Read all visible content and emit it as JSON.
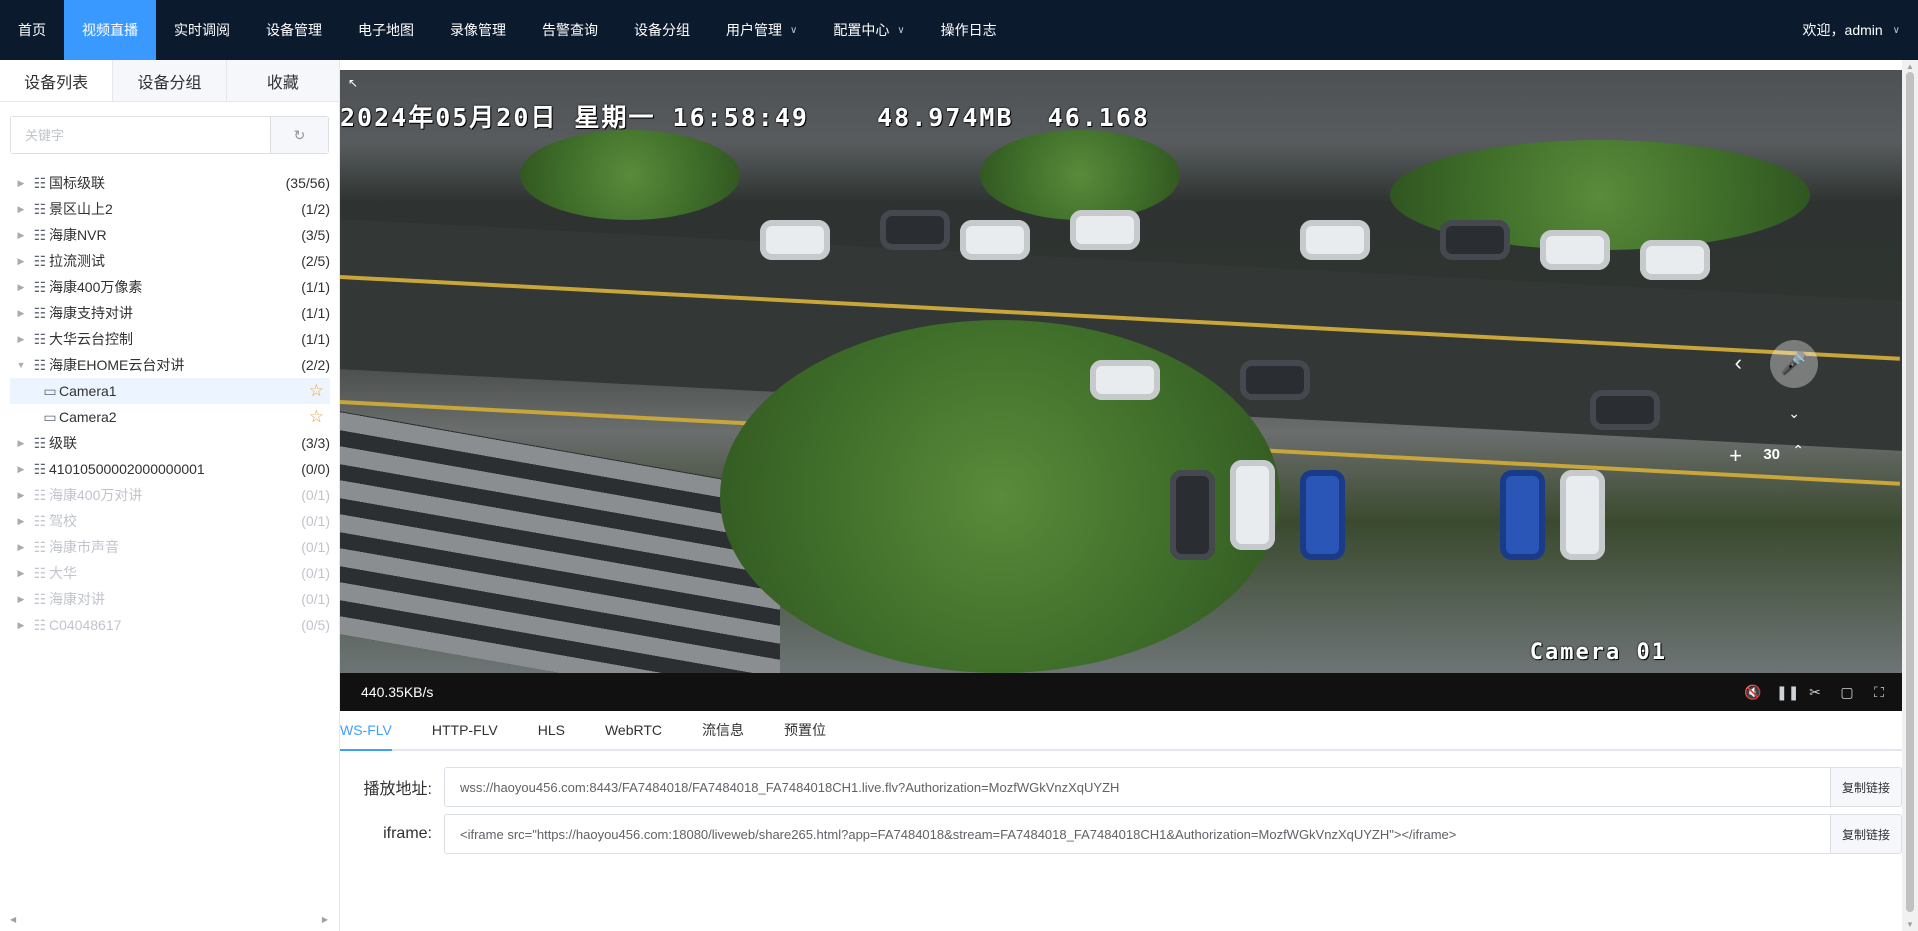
{
  "nav": {
    "items": [
      {
        "label": "首页",
        "active": false,
        "dropdown": false
      },
      {
        "label": "视频直播",
        "active": true,
        "dropdown": false
      },
      {
        "label": "实时调阅",
        "active": false,
        "dropdown": false
      },
      {
        "label": "设备管理",
        "active": false,
        "dropdown": false
      },
      {
        "label": "电子地图",
        "active": false,
        "dropdown": false
      },
      {
        "label": "录像管理",
        "active": false,
        "dropdown": false
      },
      {
        "label": "告警查询",
        "active": false,
        "dropdown": false
      },
      {
        "label": "设备分组",
        "active": false,
        "dropdown": false
      },
      {
        "label": "用户管理",
        "active": false,
        "dropdown": true
      },
      {
        "label": "配置中心",
        "active": false,
        "dropdown": true
      },
      {
        "label": "操作日志",
        "active": false,
        "dropdown": false
      }
    ],
    "user": "欢迎，admin"
  },
  "sidebar": {
    "tabs": [
      "设备列表",
      "设备分组",
      "收藏"
    ],
    "active_tab": 0,
    "search_placeholder": "关键字",
    "tree": [
      {
        "label": "国标级联",
        "count": "(35/56)",
        "type": "group",
        "expanded": false,
        "disabled": false
      },
      {
        "label": "景区山上2",
        "count": "(1/2)",
        "type": "group",
        "expanded": false,
        "disabled": false
      },
      {
        "label": "海康NVR",
        "count": "(3/5)",
        "type": "group",
        "expanded": false,
        "disabled": false
      },
      {
        "label": "拉流测试",
        "count": "(2/5)",
        "type": "group",
        "expanded": false,
        "disabled": false
      },
      {
        "label": "海康400万像素",
        "count": "(1/1)",
        "type": "group",
        "expanded": false,
        "disabled": false
      },
      {
        "label": "海康支持对讲",
        "count": "(1/1)",
        "type": "group",
        "expanded": false,
        "disabled": false
      },
      {
        "label": "大华云台控制",
        "count": "(1/1)",
        "type": "group",
        "expanded": false,
        "disabled": false
      },
      {
        "label": "海康EHOME云台对讲",
        "count": "(2/2)",
        "type": "group",
        "expanded": true,
        "disabled": false
      },
      {
        "label": "Camera1",
        "count": "",
        "type": "camera",
        "selected": true,
        "disabled": false
      },
      {
        "label": "Camera2",
        "count": "",
        "type": "camera",
        "selected": false,
        "disabled": false
      },
      {
        "label": "级联",
        "count": "(3/3)",
        "type": "group",
        "expanded": false,
        "disabled": false
      },
      {
        "label": "41010500002000000001",
        "count": "(0/0)",
        "type": "group",
        "expanded": false,
        "disabled": false
      },
      {
        "label": "海康400万对讲",
        "count": "(0/1)",
        "type": "group",
        "expanded": false,
        "disabled": true
      },
      {
        "label": "驾校",
        "count": "(0/1)",
        "type": "group",
        "expanded": false,
        "disabled": true
      },
      {
        "label": "海康市声音",
        "count": "(0/1)",
        "type": "group",
        "expanded": false,
        "disabled": true
      },
      {
        "label": "大华",
        "count": "(0/1)",
        "type": "group",
        "expanded": false,
        "disabled": true
      },
      {
        "label": "海康对讲",
        "count": "(0/1)",
        "type": "group",
        "expanded": false,
        "disabled": true
      },
      {
        "label": "C04048617",
        "count": "(0/5)",
        "type": "group",
        "expanded": false,
        "disabled": true
      }
    ]
  },
  "video": {
    "osd_top": "2024年05月20日 星期一 16:58:49    48.974MB  46.168",
    "osd_camera": "Camera 01",
    "ptz_speed": "30",
    "bitrate": "440.35KB/s"
  },
  "protocols": {
    "tabs": [
      "WS-FLV",
      "HTTP-FLV",
      "HLS",
      "WebRTC",
      "流信息",
      "预置位"
    ],
    "active": 0
  },
  "fields": {
    "play_label": "播放地址:",
    "play_url": "wss://haoyou456.com:8443/FA7484018/FA7484018_FA7484018CH1.live.flv?Authorization=MozfWGkVnzXqUYZH",
    "iframe_label": "iframe:",
    "iframe_code": "<iframe src=\"https://haoyou456.com:18080/liveweb/share265.html?app=FA7484018&stream=FA7484018_FA7484018CH1&Authorization=MozfWGkVnzXqUYZH\"></iframe>",
    "copy_label": "复制链接"
  }
}
